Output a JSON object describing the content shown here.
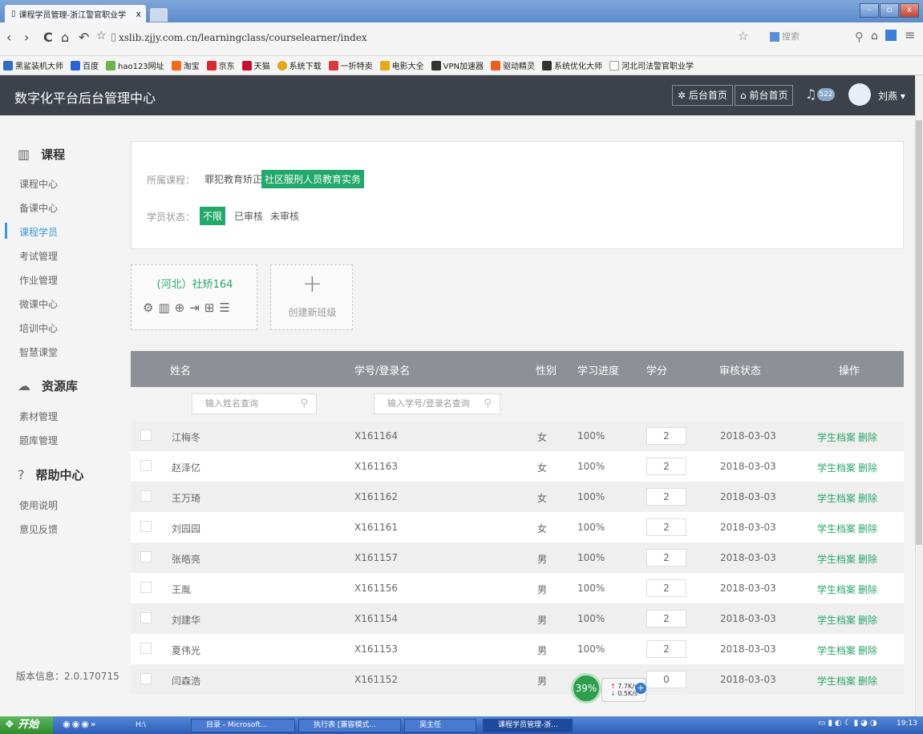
{
  "browser": {
    "tab_title": "课程学员管理-浙江警官职业学",
    "tab_close": "x",
    "url": "xslib.zjjy.com.cn/learningclass/courselearner/index",
    "search_placeholder": "搜索",
    "window_buttons": [
      "-",
      "▫",
      "x"
    ],
    "bookmarks": [
      "黑鲨装机大师",
      "百度",
      "hao123网址",
      "淘宝",
      "京东",
      "天猫",
      "系统下载",
      "一折特卖",
      "电影大全",
      "VPN加速器",
      "驱动精灵",
      "系统优化大师",
      "河北司法警官职业学"
    ]
  },
  "header": {
    "title": "数字化平台后台管理中心",
    "admin_home": "后台首页",
    "front_home": "前台首页",
    "notification_count": "522",
    "user_name": "刘燕 ▾"
  },
  "sidebar": {
    "groups": [
      {
        "title": "课程",
        "icon": "book-icon",
        "items": [
          "课程中心",
          "备课中心",
          "课程学员",
          "考试管理",
          "作业管理",
          "微课中心",
          "培训中心",
          "智慧课堂"
        ]
      },
      {
        "title": "资源库",
        "icon": "cloud-icon",
        "items": [
          "素材管理",
          "题库管理"
        ]
      },
      {
        "title": "帮助中心",
        "icon": "help-icon",
        "items": [
          "使用说明",
          "意见反馈"
        ]
      }
    ],
    "active_item": "课程学员",
    "version": "版本信息：2.0.170715"
  },
  "filters": {
    "course_label": "所属课程：",
    "course_options": [
      "罪犯教育矫正",
      "社区服刑人员教育实务"
    ],
    "course_selected": "社区服刑人员教育实务",
    "status_label": "学员状态：",
    "status_options": [
      "不限",
      "已审核",
      "未审核"
    ],
    "status_selected": "不限"
  },
  "classes": {
    "card_name": "(河北）社矫164",
    "card_icons": [
      "gear-icon",
      "trash-icon",
      "add-circle-icon",
      "import-icon",
      "split-icon",
      "list-icon"
    ],
    "new_class": "创建新班级"
  },
  "table": {
    "columns": [
      "姓名",
      "学号/登录名",
      "性别",
      "学习进度",
      "学分",
      "审核状态",
      "操作"
    ],
    "name_search_placeholder": "输入姓名查询",
    "id_search_placeholder": "输入学号/登录名查询",
    "action_profile": "学生档案",
    "action_delete": "删除",
    "rows": [
      {
        "name": "江梅冬",
        "id": "X161164",
        "gender": "女",
        "progress": "100%",
        "credit": "2",
        "date": "2018-03-03"
      },
      {
        "name": "赵泽亿",
        "id": "X161163",
        "gender": "女",
        "progress": "100%",
        "credit": "2",
        "date": "2018-03-03"
      },
      {
        "name": "王万琦",
        "id": "X161162",
        "gender": "女",
        "progress": "100%",
        "credit": "2",
        "date": "2018-03-03"
      },
      {
        "name": "刘园园",
        "id": "X161161",
        "gender": "女",
        "progress": "100%",
        "credit": "2",
        "date": "2018-03-03"
      },
      {
        "name": "张皓亮",
        "id": "X161157",
        "gender": "男",
        "progress": "100%",
        "credit": "2",
        "date": "2018-03-03"
      },
      {
        "name": "王胤",
        "id": "X161156",
        "gender": "男",
        "progress": "100%",
        "credit": "2",
        "date": "2018-03-03"
      },
      {
        "name": "刘建华",
        "id": "X161154",
        "gender": "男",
        "progress": "100%",
        "credit": "2",
        "date": "2018-03-03"
      },
      {
        "name": "夏伟光",
        "id": "X161153",
        "gender": "男",
        "progress": "100%",
        "credit": "2",
        "date": "2018-03-03"
      },
      {
        "name": "闫森浩",
        "id": "X161152",
        "gender": "男",
        "progress": "",
        "credit": "0",
        "date": "2018-03-03"
      }
    ]
  },
  "net_widget": {
    "percent": "39%",
    "up": "7.7K/s",
    "down": "0.5K/s"
  },
  "taskbar": {
    "start": "开始",
    "tasks": [
      "H:\\",
      "目录 - Microsoft...",
      "执行表 [兼容模式...",
      "吴主任",
      "课程学员管理-浙..."
    ],
    "clock": "19:13"
  }
}
